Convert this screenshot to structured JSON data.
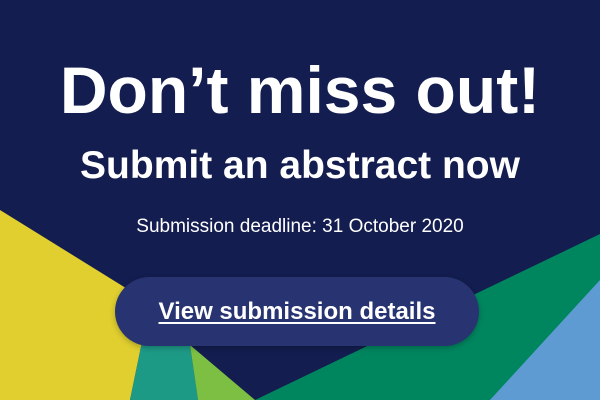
{
  "banner": {
    "headline": "Don’t miss out!",
    "subhead": "Submit an abstract now",
    "deadline": "Submission deadline: 31 October 2020",
    "cta_label": "View submission details"
  },
  "colors": {
    "background": "#131d4f",
    "button": "#273471",
    "yellow": "#e0cf2f",
    "green": "#00865f",
    "teal": "#1d9a86",
    "lime": "#7cbf42",
    "blue": "#5f9bd3",
    "text": "#ffffff"
  }
}
